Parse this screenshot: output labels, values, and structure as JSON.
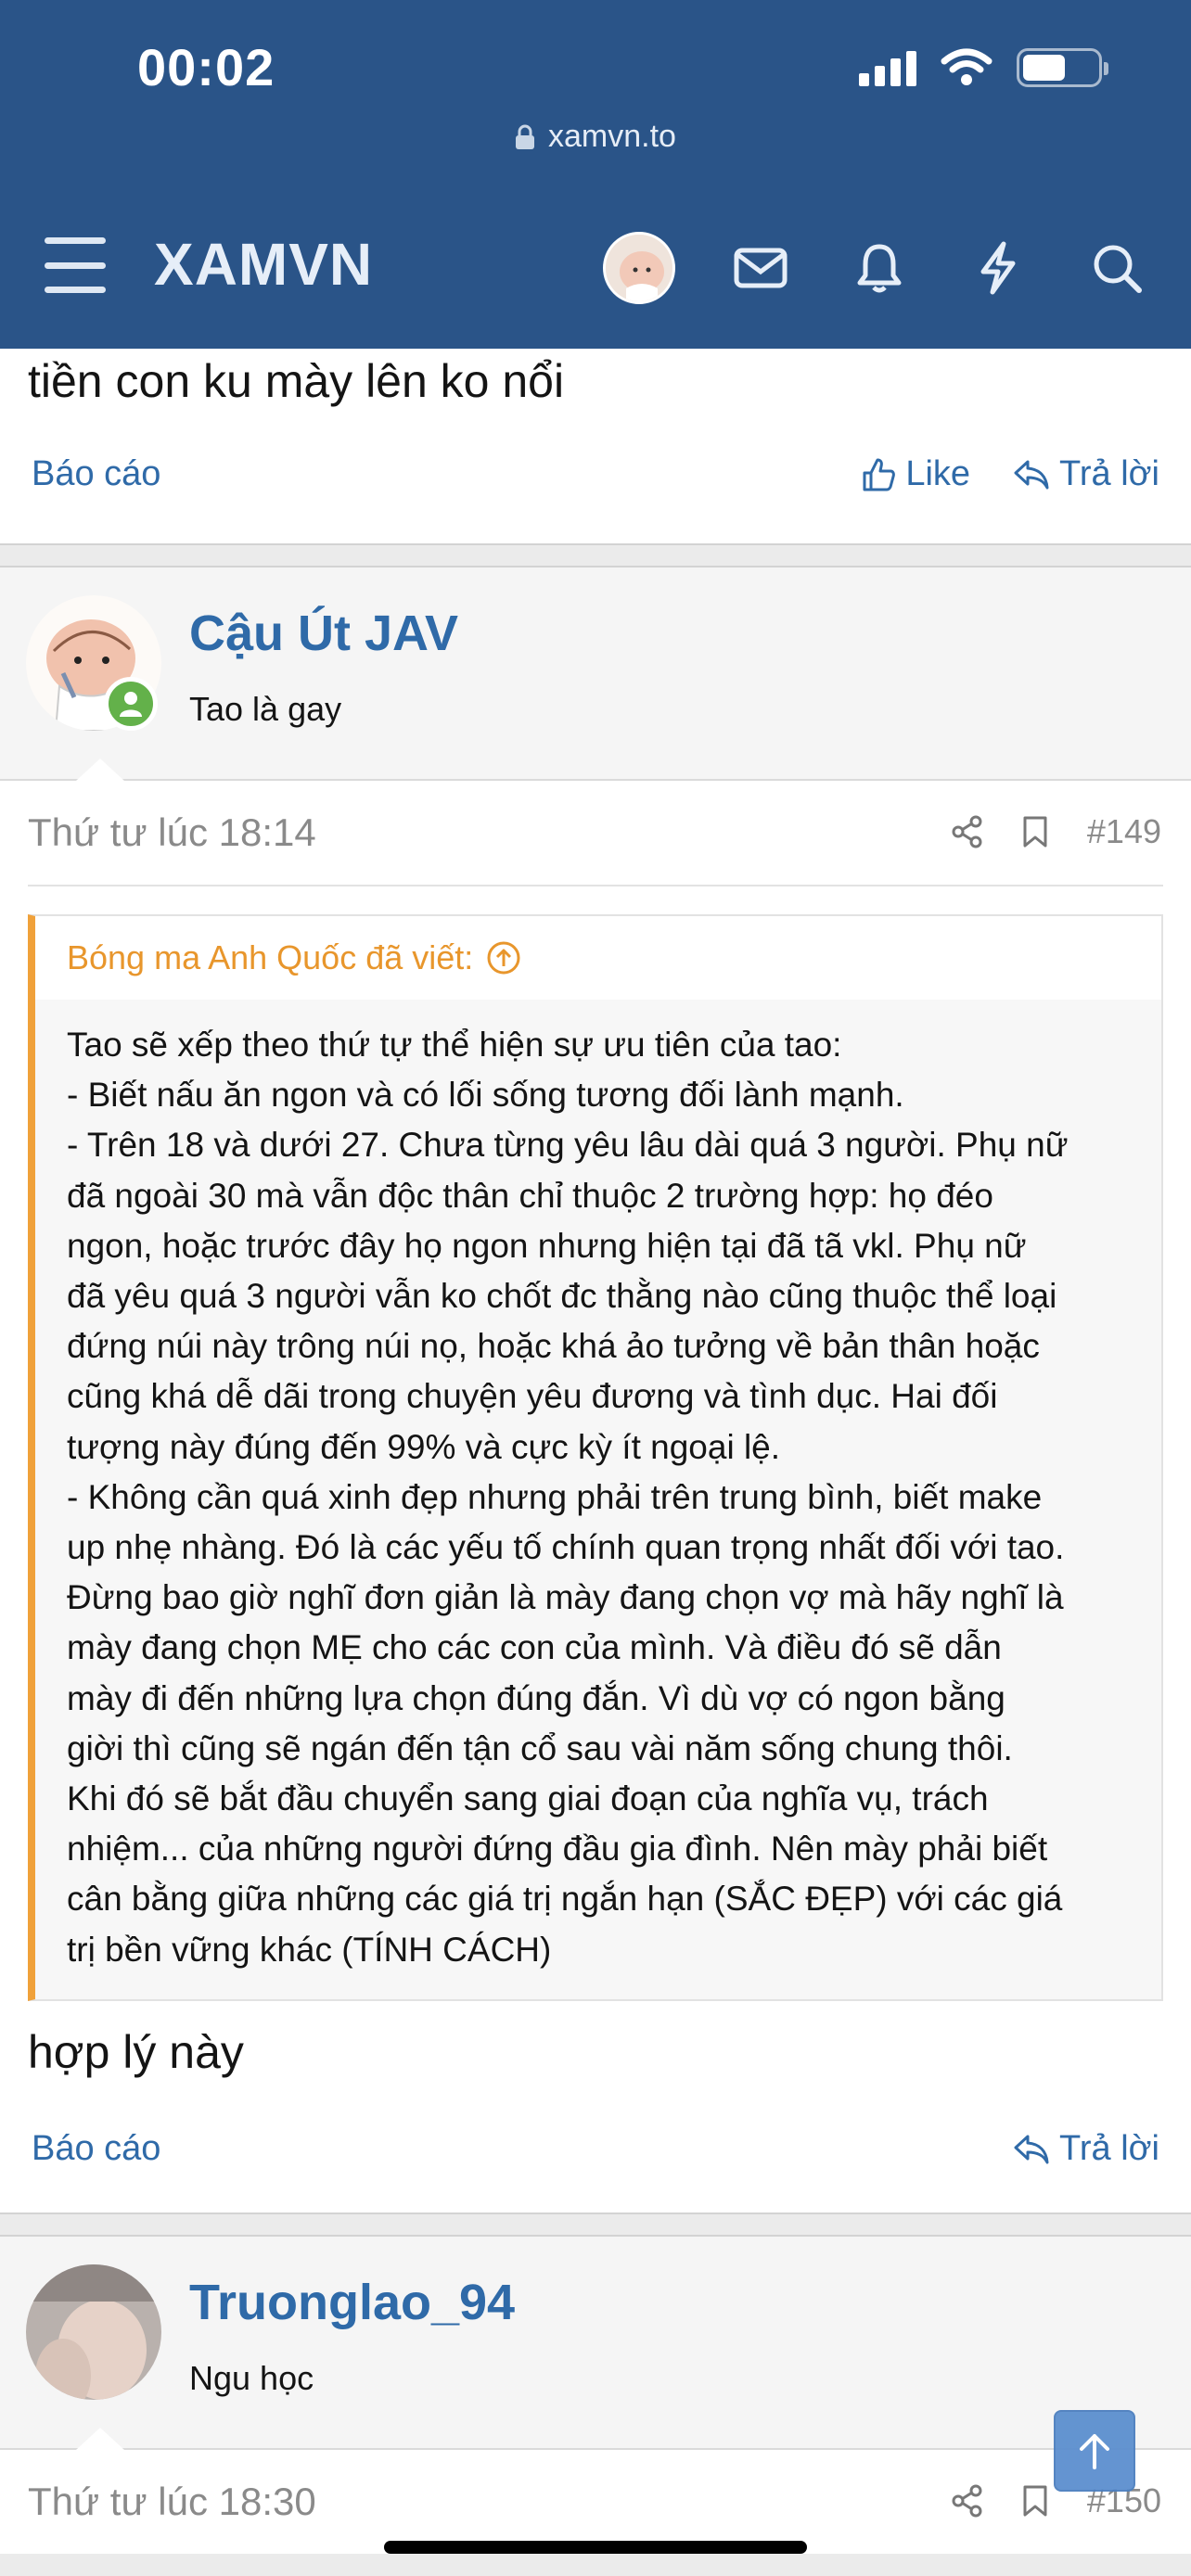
{
  "status_bar": {
    "time": "00:02"
  },
  "browser": {
    "url": "xamvn.to"
  },
  "nav": {
    "site_name": "XAMVN"
  },
  "prev_post": {
    "text_tail": "tiền con ku mày lên ko nổi",
    "report_label": "Báo cáo",
    "like_label": "Like",
    "reply_label": "Trả lời"
  },
  "post_149": {
    "username": "Cậu Út JAV",
    "user_title": "Tao là gay",
    "date": "Thứ tư lúc 18:14",
    "number": "#149",
    "quote_author": "Bóng ma Anh Quốc đã viết:",
    "quote_lines": [
      "Tao sẽ xếp theo thứ tự thể hiện sự ưu tiên của tao:",
      "- Biết nấu ăn ngon và có lối sống tương đối lành mạnh.",
      "- Trên 18 và dưới 27. Chưa từng yêu lâu dài quá 3 người. Phụ nữ",
      "đã ngoài 30 mà vẫn độc thân chỉ thuộc 2 trường hợp: họ đéo",
      "ngon, hoặc trước đây họ ngon nhưng hiện tại đã tã vkl. Phụ nữ",
      "đã yêu quá 3 người vẫn ko chốt đc thằng nào cũng thuộc thể loại",
      "đứng núi này trông núi nọ, hoặc khá ảo tưởng về bản thân hoặc",
      "cũng khá dễ dãi trong chuyện yêu đương và tình dục. Hai đối",
      "tượng này đúng đến 99% và cực kỳ ít ngoại lệ.",
      "- Không cần quá xinh đẹp nhưng phải trên trung bình, biết make",
      "up nhẹ nhàng. Đó là các yếu tố chính quan trọng nhất đối với tao.",
      "Đừng bao giờ nghĩ đơn giản là mày đang chọn vợ mà hãy nghĩ là",
      "mày đang chọn MẸ cho các con của mình. Và điều đó sẽ dẫn",
      "mày đi đến những lựa chọn đúng đắn. Vì dù vợ có ngon bằng",
      "giời thì cũng sẽ ngán đến tận cổ sau vài năm sống chung thôi.",
      "Khi đó sẽ bắt đầu chuyển sang giai đoạn của nghĩa vụ, trách",
      "nhiệm... của những người đứng đầu gia đình. Nên mày phải biết",
      "cân bằng giữa những các giá trị ngắn hạn (SẮC ĐẸP) với các giá",
      "trị bền vững khác (TÍNH CÁCH)"
    ],
    "body": "hợp lý này",
    "report_label": "Báo cáo",
    "reply_label": "Trả lời"
  },
  "post_150": {
    "username": "Truonglao_94",
    "user_title": "Ngu học",
    "date": "Thứ tư lúc 18:30",
    "number": "#150"
  },
  "colors": {
    "header_bg": "#2a5488",
    "link": "#2f6aa8",
    "quote_accent": "#f0a13a",
    "online": "#63b14a"
  }
}
